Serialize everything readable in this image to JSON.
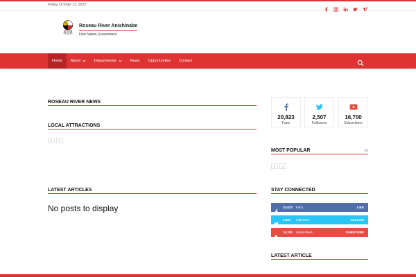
{
  "topbar": {
    "date": "Friday, October 13, 2023",
    "social_icons": [
      "facebook-icon",
      "instagram-icon",
      "linkedin-icon",
      "twitter-icon",
      "vimeo-icon"
    ]
  },
  "logo": {
    "title": "Roseau River Anishinabe",
    "subtitle": "First Nation Government"
  },
  "nav": {
    "items": [
      {
        "label": "Home",
        "active": true
      },
      {
        "label": "About",
        "dropdown": true
      },
      {
        "label": "Departments",
        "dropdown": true
      },
      {
        "label": "News"
      },
      {
        "label": "Opportunities"
      },
      {
        "label": "Contact"
      }
    ],
    "search_icon": "search-icon"
  },
  "main": {
    "roseau_news_title": "ROSEAU RIVER NEWS",
    "local_attractions_title": "LOCAL ATTRACTIONS",
    "latest_articles_title": "LATEST ARTICLES",
    "no_posts_text": "No posts to display"
  },
  "sidebar": {
    "counters": [
      {
        "icon": "facebook-icon",
        "count": "20,823",
        "label": "Fans",
        "color": "#516eab"
      },
      {
        "icon": "twitter-icon",
        "count": "2,507",
        "label": "Followers",
        "color": "#29c5f6"
      },
      {
        "icon": "youtube-icon",
        "count": "16,700",
        "label": "Subscribers",
        "color": "#e14e42"
      }
    ],
    "most_popular_title": "MOST POPULAR",
    "most_popular_all": "All",
    "stay_connected_title": "STAY CONNECTED",
    "social_bars": [
      {
        "icon": "facebook-icon",
        "count": "20,823",
        "label": "Fans",
        "action": "LIKE",
        "color": "#516eab"
      },
      {
        "icon": "twitter-icon",
        "count": "2,507",
        "label": "Followers",
        "action": "FOLLOW",
        "color": "#29c5f6"
      },
      {
        "icon": "youtube-icon",
        "count": "16,700",
        "label": "Subscribers",
        "action": "SUBSCRIBE",
        "color": "#e14e42"
      }
    ],
    "latest_article_title": "LATEST ARTICLE"
  },
  "colors": {
    "accent": "#dd3333",
    "accent_dark": "#b82424"
  }
}
